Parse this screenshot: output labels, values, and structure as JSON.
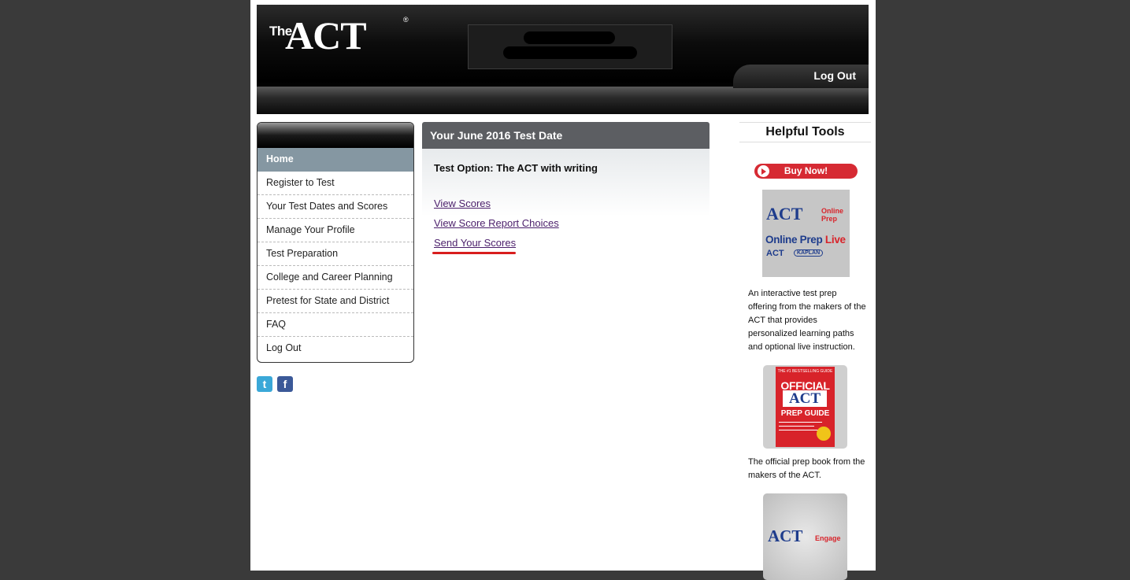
{
  "header": {
    "logo_the": "The",
    "logo_act": "ACT",
    "logo_reg": "®",
    "logout_label": "Log Out"
  },
  "sidebar": {
    "items": [
      {
        "label": "Home",
        "active": true
      },
      {
        "label": "Register to Test"
      },
      {
        "label": "Your Test Dates and Scores"
      },
      {
        "label": "Manage Your Profile"
      },
      {
        "label": "Test Preparation"
      },
      {
        "label": "College and Career Planning"
      },
      {
        "label": "Pretest for State and District"
      },
      {
        "label": "FAQ"
      },
      {
        "label": "Log Out"
      }
    ]
  },
  "social": {
    "twitter_glyph": "t",
    "facebook_glyph": "f"
  },
  "main": {
    "panel_title": "Your June 2016 Test Date",
    "test_option": "Test Option: The ACT with writing",
    "links": {
      "view_scores": "View Scores",
      "view_report_choices": "View Score Report Choices",
      "send_scores": "Send Your Scores"
    }
  },
  "right": {
    "title": "Helpful Tools",
    "buy_now": "Buy Now!",
    "ad1": {
      "act": "ACT",
      "online_prep_small": "Online Prep",
      "online_prep": "Online Prep",
      "live": "Live",
      "act_small": "ACT",
      "kaplan": "KAPLAN"
    },
    "ad1_desc": "An interactive test prep offering from the makers of the ACT that provides personalized learning paths and optional live instruction.",
    "ad2": {
      "top": "THE #1 BESTSELLING GUIDE",
      "official": "OFFICIAL",
      "act": "ACT",
      "guide": "PREP GUIDE"
    },
    "ad2_desc": "The official prep book from the makers of the ACT.",
    "ad3": {
      "act": "ACT",
      "engage": "Engage"
    }
  },
  "colors": {
    "page_bg": "#3a3a3a",
    "nav_active": "#8597a2",
    "panel_header": "#5c5e62",
    "link": "#4b1f6b",
    "highlight_underline": "#d81e1e",
    "buy_button": "#d62a33"
  }
}
